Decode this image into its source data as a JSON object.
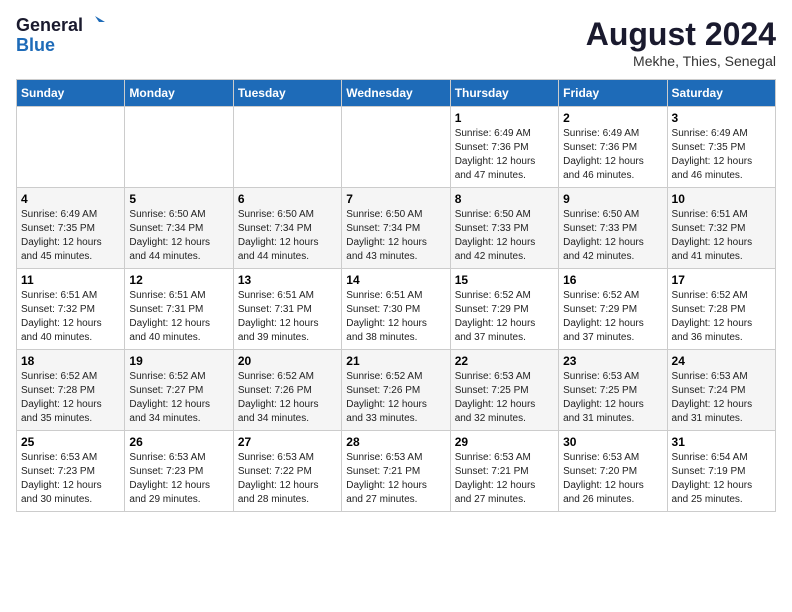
{
  "logo": {
    "line1": "General",
    "line2": "Blue"
  },
  "title": "August 2024",
  "subtitle": "Mekhe, Thies, Senegal",
  "days_of_week": [
    "Sunday",
    "Monday",
    "Tuesday",
    "Wednesday",
    "Thursday",
    "Friday",
    "Saturday"
  ],
  "weeks": [
    [
      {
        "day": "",
        "info": ""
      },
      {
        "day": "",
        "info": ""
      },
      {
        "day": "",
        "info": ""
      },
      {
        "day": "",
        "info": ""
      },
      {
        "day": "1",
        "info": "Sunrise: 6:49 AM\nSunset: 7:36 PM\nDaylight: 12 hours\nand 47 minutes."
      },
      {
        "day": "2",
        "info": "Sunrise: 6:49 AM\nSunset: 7:36 PM\nDaylight: 12 hours\nand 46 minutes."
      },
      {
        "day": "3",
        "info": "Sunrise: 6:49 AM\nSunset: 7:35 PM\nDaylight: 12 hours\nand 46 minutes."
      }
    ],
    [
      {
        "day": "4",
        "info": "Sunrise: 6:49 AM\nSunset: 7:35 PM\nDaylight: 12 hours\nand 45 minutes."
      },
      {
        "day": "5",
        "info": "Sunrise: 6:50 AM\nSunset: 7:34 PM\nDaylight: 12 hours\nand 44 minutes."
      },
      {
        "day": "6",
        "info": "Sunrise: 6:50 AM\nSunset: 7:34 PM\nDaylight: 12 hours\nand 44 minutes."
      },
      {
        "day": "7",
        "info": "Sunrise: 6:50 AM\nSunset: 7:34 PM\nDaylight: 12 hours\nand 43 minutes."
      },
      {
        "day": "8",
        "info": "Sunrise: 6:50 AM\nSunset: 7:33 PM\nDaylight: 12 hours\nand 42 minutes."
      },
      {
        "day": "9",
        "info": "Sunrise: 6:50 AM\nSunset: 7:33 PM\nDaylight: 12 hours\nand 42 minutes."
      },
      {
        "day": "10",
        "info": "Sunrise: 6:51 AM\nSunset: 7:32 PM\nDaylight: 12 hours\nand 41 minutes."
      }
    ],
    [
      {
        "day": "11",
        "info": "Sunrise: 6:51 AM\nSunset: 7:32 PM\nDaylight: 12 hours\nand 40 minutes."
      },
      {
        "day": "12",
        "info": "Sunrise: 6:51 AM\nSunset: 7:31 PM\nDaylight: 12 hours\nand 40 minutes."
      },
      {
        "day": "13",
        "info": "Sunrise: 6:51 AM\nSunset: 7:31 PM\nDaylight: 12 hours\nand 39 minutes."
      },
      {
        "day": "14",
        "info": "Sunrise: 6:51 AM\nSunset: 7:30 PM\nDaylight: 12 hours\nand 38 minutes."
      },
      {
        "day": "15",
        "info": "Sunrise: 6:52 AM\nSunset: 7:29 PM\nDaylight: 12 hours\nand 37 minutes."
      },
      {
        "day": "16",
        "info": "Sunrise: 6:52 AM\nSunset: 7:29 PM\nDaylight: 12 hours\nand 37 minutes."
      },
      {
        "day": "17",
        "info": "Sunrise: 6:52 AM\nSunset: 7:28 PM\nDaylight: 12 hours\nand 36 minutes."
      }
    ],
    [
      {
        "day": "18",
        "info": "Sunrise: 6:52 AM\nSunset: 7:28 PM\nDaylight: 12 hours\nand 35 minutes."
      },
      {
        "day": "19",
        "info": "Sunrise: 6:52 AM\nSunset: 7:27 PM\nDaylight: 12 hours\nand 34 minutes."
      },
      {
        "day": "20",
        "info": "Sunrise: 6:52 AM\nSunset: 7:26 PM\nDaylight: 12 hours\nand 34 minutes."
      },
      {
        "day": "21",
        "info": "Sunrise: 6:52 AM\nSunset: 7:26 PM\nDaylight: 12 hours\nand 33 minutes."
      },
      {
        "day": "22",
        "info": "Sunrise: 6:53 AM\nSunset: 7:25 PM\nDaylight: 12 hours\nand 32 minutes."
      },
      {
        "day": "23",
        "info": "Sunrise: 6:53 AM\nSunset: 7:25 PM\nDaylight: 12 hours\nand 31 minutes."
      },
      {
        "day": "24",
        "info": "Sunrise: 6:53 AM\nSunset: 7:24 PM\nDaylight: 12 hours\nand 31 minutes."
      }
    ],
    [
      {
        "day": "25",
        "info": "Sunrise: 6:53 AM\nSunset: 7:23 PM\nDaylight: 12 hours\nand 30 minutes."
      },
      {
        "day": "26",
        "info": "Sunrise: 6:53 AM\nSunset: 7:23 PM\nDaylight: 12 hours\nand 29 minutes."
      },
      {
        "day": "27",
        "info": "Sunrise: 6:53 AM\nSunset: 7:22 PM\nDaylight: 12 hours\nand 28 minutes."
      },
      {
        "day": "28",
        "info": "Sunrise: 6:53 AM\nSunset: 7:21 PM\nDaylight: 12 hours\nand 27 minutes."
      },
      {
        "day": "29",
        "info": "Sunrise: 6:53 AM\nSunset: 7:21 PM\nDaylight: 12 hours\nand 27 minutes."
      },
      {
        "day": "30",
        "info": "Sunrise: 6:53 AM\nSunset: 7:20 PM\nDaylight: 12 hours\nand 26 minutes."
      },
      {
        "day": "31",
        "info": "Sunrise: 6:54 AM\nSunset: 7:19 PM\nDaylight: 12 hours\nand 25 minutes."
      }
    ]
  ]
}
